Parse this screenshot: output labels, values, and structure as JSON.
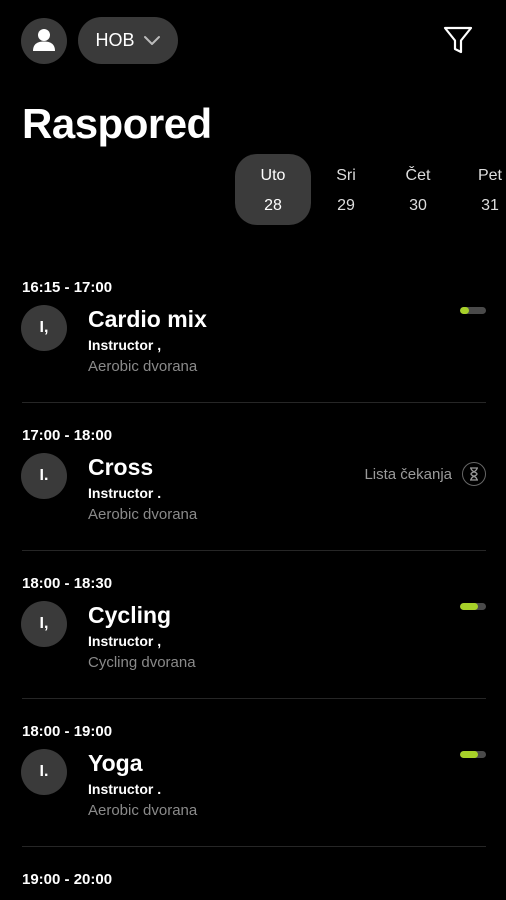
{
  "header": {
    "gym_label": "HOB",
    "title": "Raspored"
  },
  "days": [
    {
      "name": "Uto",
      "num": "28",
      "selected": true
    },
    {
      "name": "Sri",
      "num": "29",
      "selected": false
    },
    {
      "name": "Čet",
      "num": "30",
      "selected": false
    },
    {
      "name": "Pet",
      "num": "31",
      "selected": false
    }
  ],
  "sessions": [
    {
      "time": "16:15 - 17:00",
      "initials": "I,",
      "name": "Cardio mix",
      "instructor": "Instructor ,",
      "hall": "Aerobic dvorana",
      "capacity_fraction": 0.35
    },
    {
      "time": "17:00 - 18:00",
      "initials": "I.",
      "name": "Cross",
      "instructor": "Instructor .",
      "hall": "Aerobic dvorana",
      "waitlist_label": "Lista čekanja"
    },
    {
      "time": "18:00 - 18:30",
      "initials": "I,",
      "name": "Cycling",
      "instructor": "Instructor ,",
      "hall": "Cycling dvorana",
      "capacity_fraction": 0.7
    },
    {
      "time": "18:00 - 19:00",
      "initials": "I.",
      "name": "Yoga",
      "instructor": "Instructor .",
      "hall": "Aerobic dvorana",
      "capacity_fraction": 0.7
    },
    {
      "time": "19:00 - 20:00"
    }
  ],
  "colors": {
    "accent": "#a7d129",
    "background": "#000000",
    "surface": "#3a3a3a"
  },
  "icons": {
    "profile": "person-icon",
    "dropdown": "chevron-down-icon",
    "filter": "filter-icon",
    "waitlist": "hourglass-icon"
  }
}
